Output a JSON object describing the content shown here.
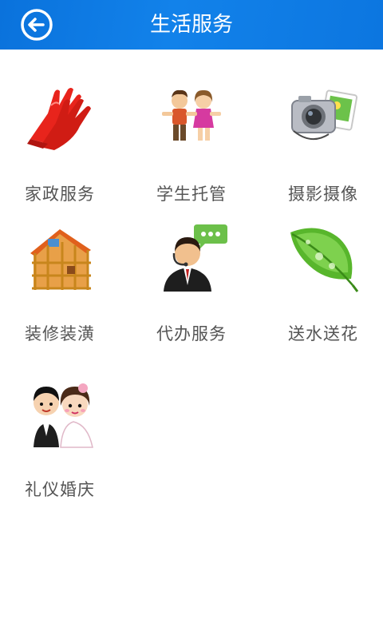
{
  "header": {
    "title": "生活服务",
    "background": "#0c78e2"
  },
  "services": [
    {
      "label": "家政服务",
      "icon": "rubber-gloves-icon"
    },
    {
      "label": "学生托管",
      "icon": "children-icon"
    },
    {
      "label": "摄影摄像",
      "icon": "camera-photo-icon"
    },
    {
      "label": "装修装潢",
      "icon": "house-construction-icon"
    },
    {
      "label": "代办服务",
      "icon": "agent-chat-icon"
    },
    {
      "label": "送水送花",
      "icon": "green-leaf-icon"
    },
    {
      "label": "礼仪婚庆",
      "icon": "wedding-couple-icon"
    }
  ]
}
